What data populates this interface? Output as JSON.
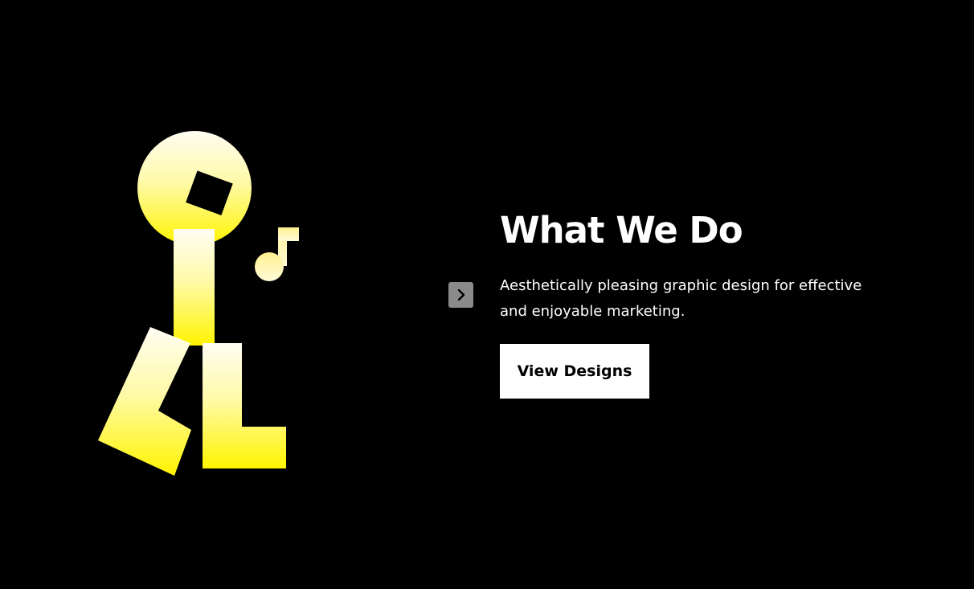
{
  "hero": {
    "title": "What We Do",
    "description": "Aesthetically pleasing graphic design for effective and enjoyable marketing.",
    "cta_label": "View Designs",
    "carousel_next_icon": "chevron-right-icon",
    "illustration": "walking-figure-music-note-icon"
  },
  "colors": {
    "background": "#000000",
    "text": "#ffffff",
    "button_bg": "#ffffff",
    "button_text": "#000000",
    "arrow_bg": "#8a8a8a",
    "figure_top": "#fffbea",
    "figure_bottom": "#fff200"
  }
}
